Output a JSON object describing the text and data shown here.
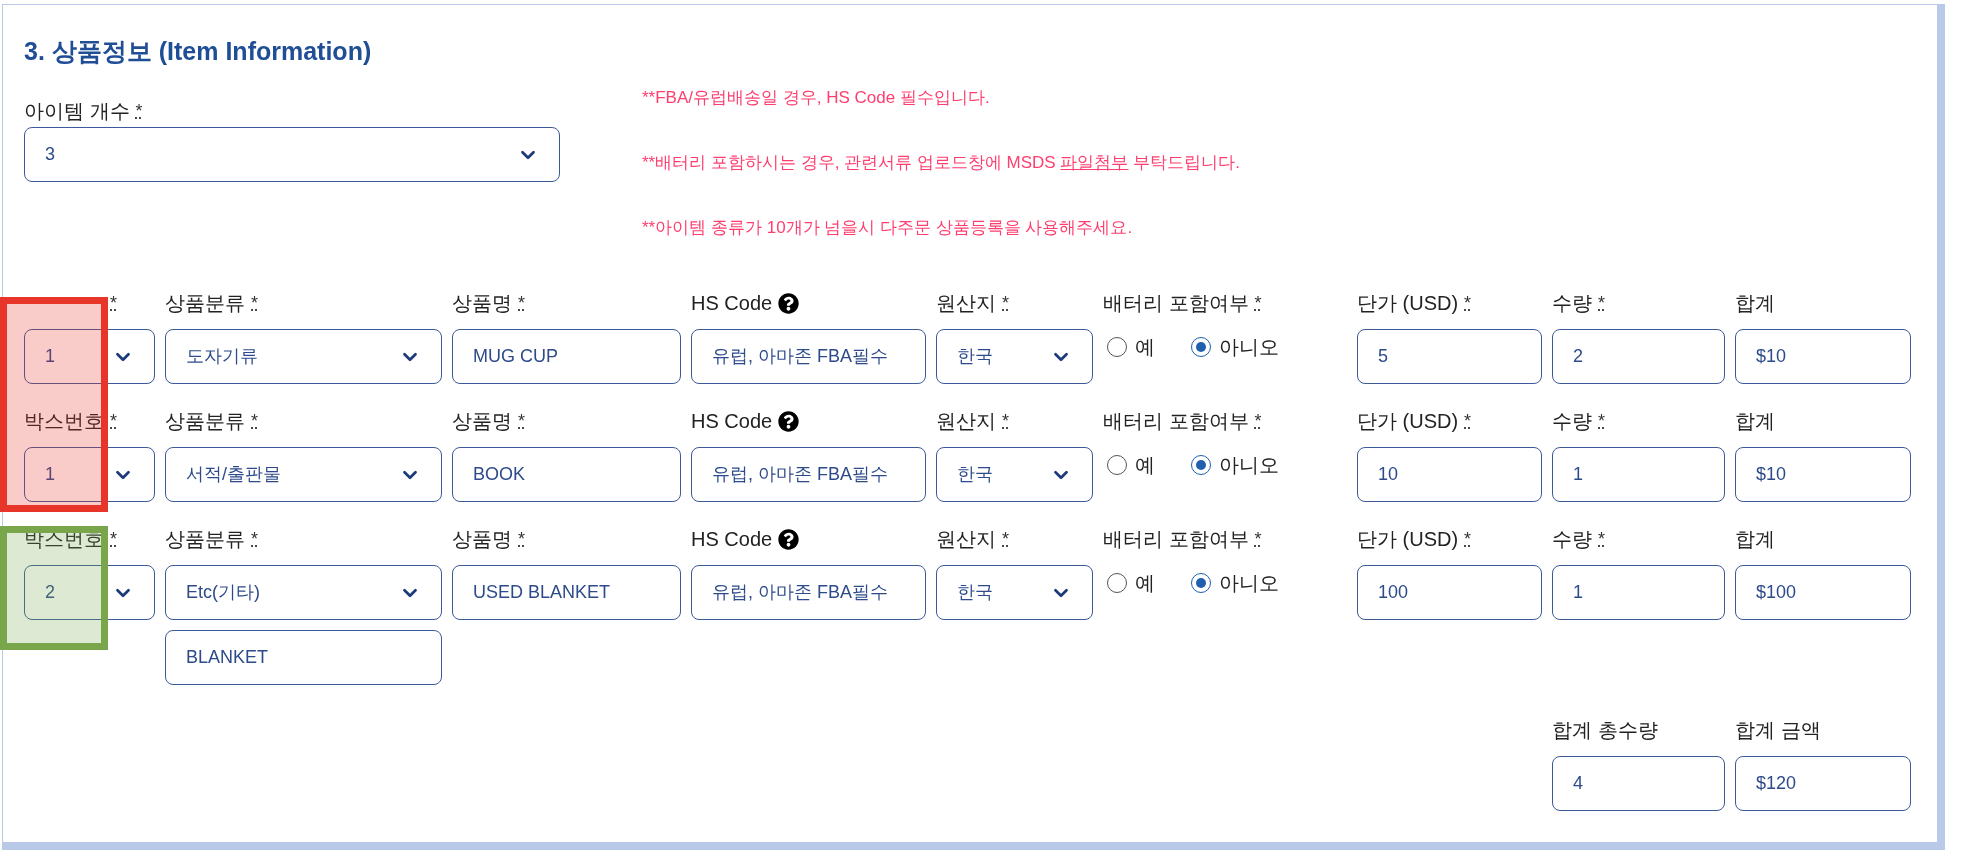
{
  "title": "3. 상품정보 (Item Information)",
  "item_count": {
    "label": "아이템 개수",
    "mark": "*",
    "value": "3"
  },
  "notices": [
    {
      "text": "**FBA/유럽배송일 경우, HS Code 필수입니다."
    },
    {
      "text": "**배터리 포함하시는 경우, 관련서류 업로드창에 MSDS ",
      "link": "파일첨부",
      "after": " 부탁드립니다."
    },
    {
      "text": "**아이템 종류가 10개가 넘을시 다주문 상품등록을 사용해주세요."
    }
  ],
  "rows": [
    {
      "fields": [
        {
          "kind": "select",
          "mark": "*",
          "value": "1"
        },
        {
          "kind": "select",
          "label": "상품분류",
          "mark": "*",
          "value": "도자기류"
        },
        {
          "kind": "input",
          "label": "상품명",
          "mark": "*",
          "value": "MUG CUP"
        },
        {
          "kind": "help",
          "label": "HS Code",
          "placeholder": "유럽, 아마존 FBA필수"
        },
        {
          "kind": "select",
          "label": "원산지",
          "mark": "*",
          "value": "한국"
        },
        {
          "kind": "radio",
          "label": "배터리 포함여부",
          "mark": "*",
          "options": [
            {
              "label": "예",
              "selected": false
            },
            {
              "label": "아니오",
              "selected": true
            }
          ]
        },
        {
          "kind": "input",
          "label": "단가 (USD)",
          "mark": "*",
          "value": "5"
        },
        {
          "kind": "input",
          "label": "수량",
          "mark": "*",
          "value": "2"
        },
        {
          "kind": "input",
          "label": "합계",
          "value": "$10"
        }
      ]
    },
    {
      "fields": [
        {
          "kind": "select",
          "label": "박스번호",
          "mark": "*",
          "value": "1"
        },
        {
          "kind": "select",
          "label": "상품분류",
          "mark": "*",
          "value": "서적/출판물"
        },
        {
          "kind": "input",
          "label": "상품명",
          "mark": "*",
          "value": "BOOK"
        },
        {
          "kind": "help",
          "label": "HS Code",
          "placeholder": "유럽, 아마존 FBA필수"
        },
        {
          "kind": "select",
          "label": "원산지",
          "mark": "*",
          "value": "한국"
        },
        {
          "kind": "radio",
          "label": "배터리 포함여부",
          "mark": "*",
          "options": [
            {
              "label": "예",
              "selected": false
            },
            {
              "label": "아니오",
              "selected": true
            }
          ]
        },
        {
          "kind": "input",
          "label": "단가 (USD)",
          "mark": "*",
          "value": "10"
        },
        {
          "kind": "input",
          "label": "수량",
          "mark": "*",
          "value": "1"
        },
        {
          "kind": "input",
          "label": "합계",
          "value": "$10"
        }
      ]
    },
    {
      "fields": [
        {
          "kind": "select",
          "label": "박스번호",
          "mark": "*",
          "value": "2"
        },
        {
          "kind": "select",
          "label": "상품분류",
          "mark": "*",
          "value": "Etc(기타)",
          "extra": "BLANKET"
        },
        {
          "kind": "input",
          "label": "상품명",
          "mark": "*",
          "value": "USED BLANKET"
        },
        {
          "kind": "help",
          "label": "HS Code",
          "placeholder": "유럽, 아마존 FBA필수"
        },
        {
          "kind": "select",
          "label": "원산지",
          "mark": "*",
          "value": "한국"
        },
        {
          "kind": "radio",
          "label": "배터리 포함여부",
          "mark": "*",
          "options": [
            {
              "label": "예",
              "selected": false
            },
            {
              "label": "아니오",
              "selected": true
            }
          ]
        },
        {
          "kind": "input",
          "label": "단가 (USD)",
          "mark": "*",
          "value": "100"
        },
        {
          "kind": "input",
          "label": "수량",
          "mark": "*",
          "value": "1"
        },
        {
          "kind": "input",
          "label": "합계",
          "value": "$100"
        }
      ]
    }
  ],
  "totals": [
    {
      "label": "합계 총수량",
      "value": "4"
    },
    {
      "label": "합계 금액",
      "value": "$120"
    }
  ],
  "highlights": [
    {
      "color": "#e8352a"
    },
    {
      "color": "#79a64b"
    }
  ]
}
